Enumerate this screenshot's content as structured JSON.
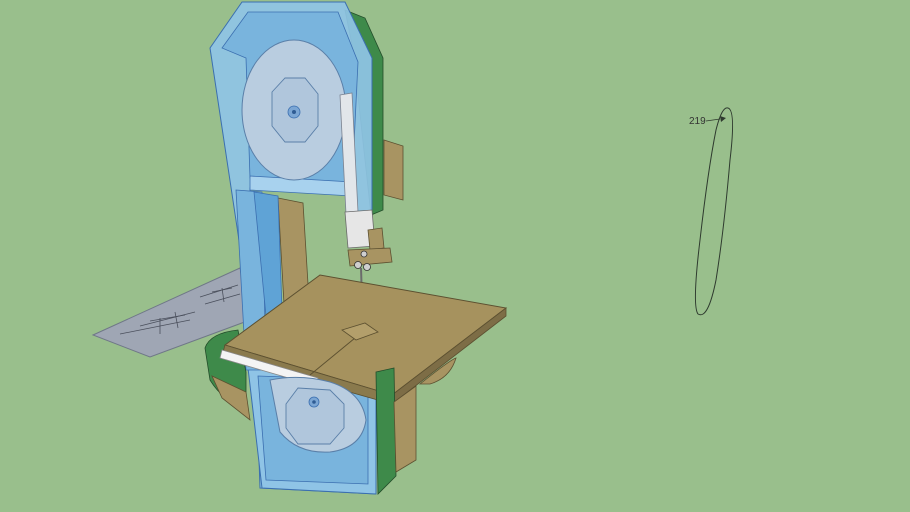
{
  "viewport": {
    "background": "#99bf8c"
  },
  "model": {
    "subject": "band-saw",
    "colors": {
      "frame_blue": "#8fc4e6",
      "frame_blue_dark": "#5fa3d6",
      "frame_edge": "#3b6fb0",
      "side_green": "#3e8a4a",
      "side_green_dark": "#2f6e3a",
      "wood_tan": "#a89462",
      "wood_dark": "#7d6d46",
      "table_top": "#a6925e",
      "wheel": "#b9cde0",
      "blade_guide": "#d8d8d8",
      "white_strip": "#f4f4f4",
      "plan_sheet": "#9fa6b4"
    }
  },
  "annotations": {
    "dimension_label": "219"
  }
}
